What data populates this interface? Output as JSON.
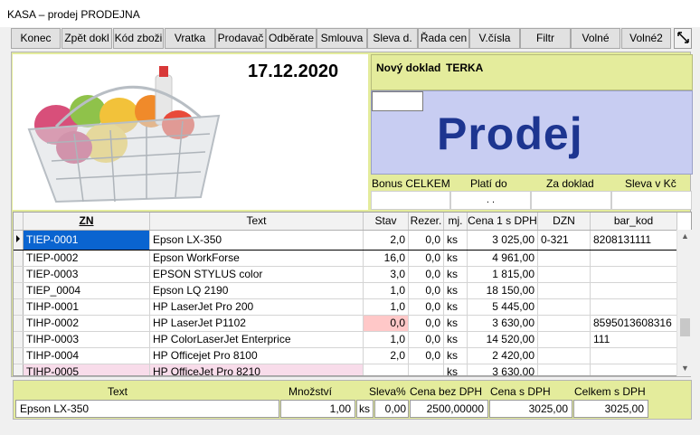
{
  "window": {
    "title": "KASA – prodej PRODEJNA"
  },
  "toolbar": {
    "buttons": [
      "Konec",
      "Zpět dokl",
      "Kód zboži",
      "Vratka",
      "Prodavač",
      "Odběrate",
      "Smlouva",
      "Sleva d.",
      "Řada cen",
      "V.čísla",
      "Filtr",
      "Volné",
      "Volné2"
    ],
    "resize_icon": "resize-arrows-icon"
  },
  "header": {
    "date": "17.12.2020",
    "new_doc_label": "Nový doklad",
    "new_doc_value": "TERKA",
    "mode_label": "Prodej",
    "basket_icon": "shopping-basket-icon"
  },
  "bonus": {
    "labels": [
      "Bonus CELKEM",
      "Platí do",
      "Za doklad",
      "Sleva v Kč"
    ],
    "plati_do_value": ". ."
  },
  "grid": {
    "columns": [
      "ZN",
      "Text",
      "Stav",
      "Rezer.",
      "mj.",
      "Cena 1 s DPH",
      "DZN",
      "bar_kod"
    ],
    "rows": [
      [
        "TIEP-0001",
        "Epson LX-350",
        "2,0",
        "0,0",
        "ks",
        "3 025,00",
        "0-321",
        "8208131111"
      ],
      [
        "TIEP-0002",
        "Epson WorkForse",
        "16,0",
        "0,0",
        "ks",
        "4 961,00",
        "",
        ""
      ],
      [
        "TIEP-0003",
        "EPSON STYLUS color",
        "3,0",
        "0,0",
        "ks",
        "1 815,00",
        "",
        ""
      ],
      [
        "TIEP_0004",
        "Epson LQ 2190",
        "1,0",
        "0,0",
        "ks",
        "18 150,00",
        "",
        ""
      ],
      [
        "TIHP-0001",
        "HP LaserJet Pro 200",
        "1,0",
        "0,0",
        "ks",
        "5 445,00",
        "",
        ""
      ],
      [
        "TIHP-0002",
        "HP LaserJet P1102",
        "0,0",
        "0,0",
        "ks",
        "3 630,00",
        "",
        "8595013608316"
      ],
      [
        "TIHP-0003",
        "HP ColorLaserJet Enterprice",
        "1,0",
        "0,0",
        "ks",
        "14 520,00",
        "",
        "111"
      ],
      [
        "TIHP-0004",
        "HP Officejet Pro 8100",
        "2,0",
        "0,0",
        "ks",
        "2 420,00",
        "",
        ""
      ],
      [
        "TIHP-0005",
        "HP OfficeJet Pro 8210",
        "",
        "",
        "ks",
        "3 630,00",
        "",
        ""
      ]
    ],
    "selected_row": 0,
    "row_indicator_icon": "row-pointer-icon"
  },
  "detail": {
    "labels": [
      "Text",
      "Množství",
      "Sleva%",
      "Cena bez DPH",
      "Cena s DPH",
      "Celkem s DPH"
    ],
    "text": "Epson LX-350",
    "mnozstvi": "1,00",
    "mj": "ks",
    "sleva": "0,00",
    "cena_bez_dph": "2500,00000",
    "cena_s_dph": "3025,00",
    "celkem_s_dph": "3025,00"
  },
  "colors": {
    "panel": "#e4ec9c",
    "prodej_bg": "#c8cdf2",
    "prodej_text": "#1d3590",
    "selection": "#0a64d0",
    "pink_row": "#f8dcea",
    "low_stock": "#ffc8c8"
  }
}
